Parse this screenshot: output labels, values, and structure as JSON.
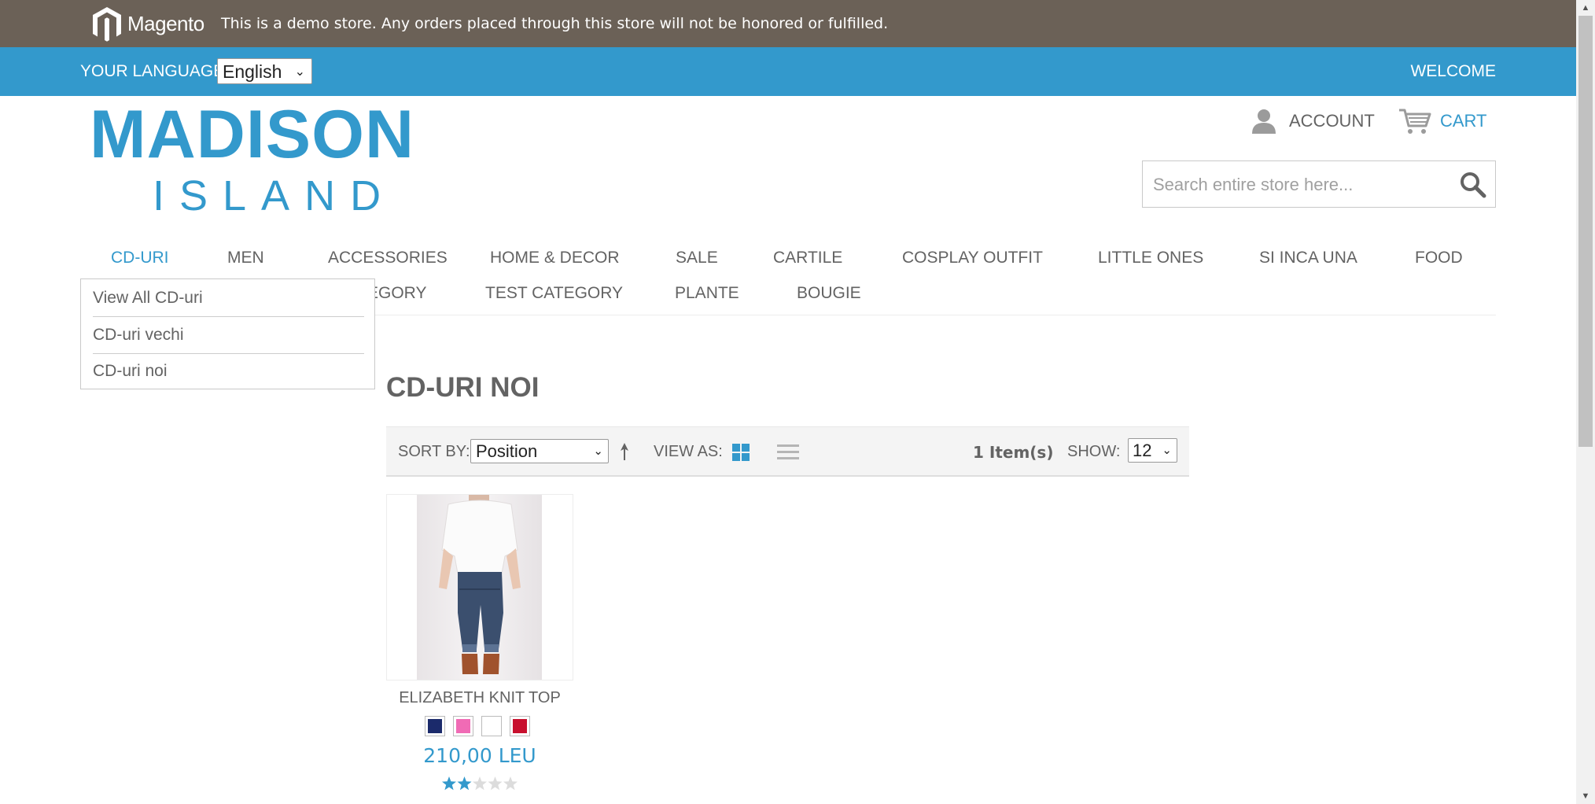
{
  "demo_notice": {
    "brand": "Magento",
    "text": "This is a demo store. Any orders placed through this store will not be honored or fulfilled."
  },
  "language_bar": {
    "label": "YOUR LANGUAGE:",
    "selected_language": "English",
    "welcome": "WELCOME"
  },
  "header": {
    "logo_line1": "MADISON",
    "logo_line2": "ISLAND",
    "account_label": "ACCOUNT",
    "cart_label": "CART",
    "search_placeholder": "Search entire store here..."
  },
  "nav": {
    "row1": [
      "CD-URI",
      "MEN",
      "ACCESSORIES",
      "HOME & DECOR",
      "SALE",
      "CARTILE",
      "COSPLAY OUTFIT",
      "LITTLE ONES",
      "SI INCA UNA",
      "FOOD"
    ],
    "row2": [
      "EGORY",
      "TEST CATEGORY",
      "PLANTE",
      "BOUGIE"
    ],
    "active": "CD-URI"
  },
  "dropdown": {
    "items": [
      "View All CD-uri",
      "CD-uri vechi",
      "CD-uri noi"
    ]
  },
  "page_title": "CD-URI NOI",
  "toolbar": {
    "sort_by_label": "SORT BY:",
    "sort_value": "Position",
    "view_as_label": "VIEW AS:",
    "item_count": "1 Item(s)",
    "show_label": "SHOW:",
    "show_value": "12"
  },
  "products": [
    {
      "name": "ELIZABETH KNIT TOP",
      "price": "210,00 LEU",
      "swatch_colors": [
        "#1b2a6b",
        "#f06bb5",
        "#ffffff",
        "#c8102e"
      ],
      "rating_stars": 2,
      "rating_max": 5
    }
  ],
  "colors": {
    "accent": "#3399cc",
    "demo_bar": "#6b6157",
    "text": "#636363"
  }
}
